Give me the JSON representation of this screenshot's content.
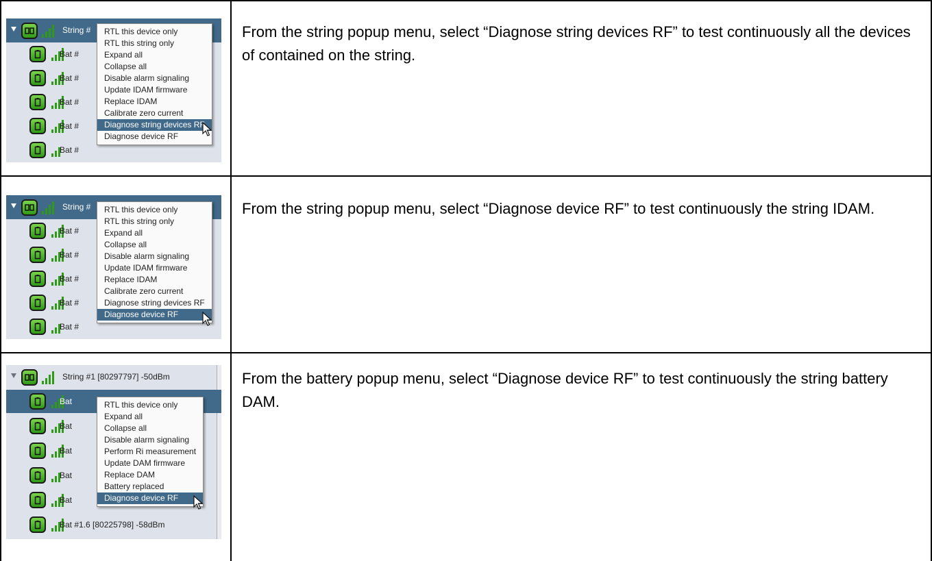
{
  "rows": [
    {
      "description": "From the string popup menu, select “Diagnose string devices RF” to test continuously all the devices of contained on the string.",
      "screenshot": {
        "header_label": "String #",
        "tree_labels": [
          "Bat #",
          "Bat #",
          "Bat #",
          "Bat #",
          "Bat #"
        ],
        "menu_items": [
          "RTL this device only",
          "RTL this string only",
          "Expand all",
          "Collapse all",
          "Disable alarm signaling",
          "Update IDAM firmware",
          "Replace IDAM",
          "Calibrate zero current",
          "Diagnose string devices RF",
          "Diagnose device RF"
        ],
        "highlighted_item": "Diagnose string devices RF"
      }
    },
    {
      "description": "From the string popup menu, select “Diagnose device RF” to test continuously the string IDAM.",
      "screenshot": {
        "header_label": "String #",
        "tree_labels": [
          "Bat #",
          "Bat #",
          "Bat #",
          "Bat #",
          "Bat #"
        ],
        "menu_items": [
          "RTL this device only",
          "RTL this string only",
          "Expand all",
          "Collapse all",
          "Disable alarm signaling",
          "Update IDAM firmware",
          "Replace IDAM",
          "Calibrate zero current",
          "Diagnose string devices RF",
          "Diagnose device RF"
        ],
        "highlighted_item": "Diagnose device RF"
      }
    },
    {
      "description": "From the battery popup menu, select “Diagnose device RF” to test continuously the string battery DAM.",
      "screenshot": {
        "header_label": "String #1 [80297797] -50dBm",
        "tree_labels": [
          "Bat",
          "Bat",
          "Bat",
          "Bat",
          "Bat",
          "Bat #1.6 [80225798] -58dBm"
        ],
        "menu_items": [
          "RTL this device only",
          "Expand all",
          "Collapse all",
          "Disable alarm signaling",
          "Perform Ri measurement",
          "Update DAM firmware",
          "Replace DAM",
          "Battery replaced",
          "Diagnose device RF"
        ],
        "highlighted_item": "Diagnose device RF"
      }
    }
  ],
  "colors": {
    "selection": "#416989",
    "panel_bg": "#dee2ea",
    "device_icon": "#2f9a17",
    "signal": "#2f9a17"
  },
  "icons": [
    "caret-down-icon",
    "string-device-icon",
    "battery-icon",
    "signal-bars-icon",
    "mouse-cursor-icon"
  ]
}
